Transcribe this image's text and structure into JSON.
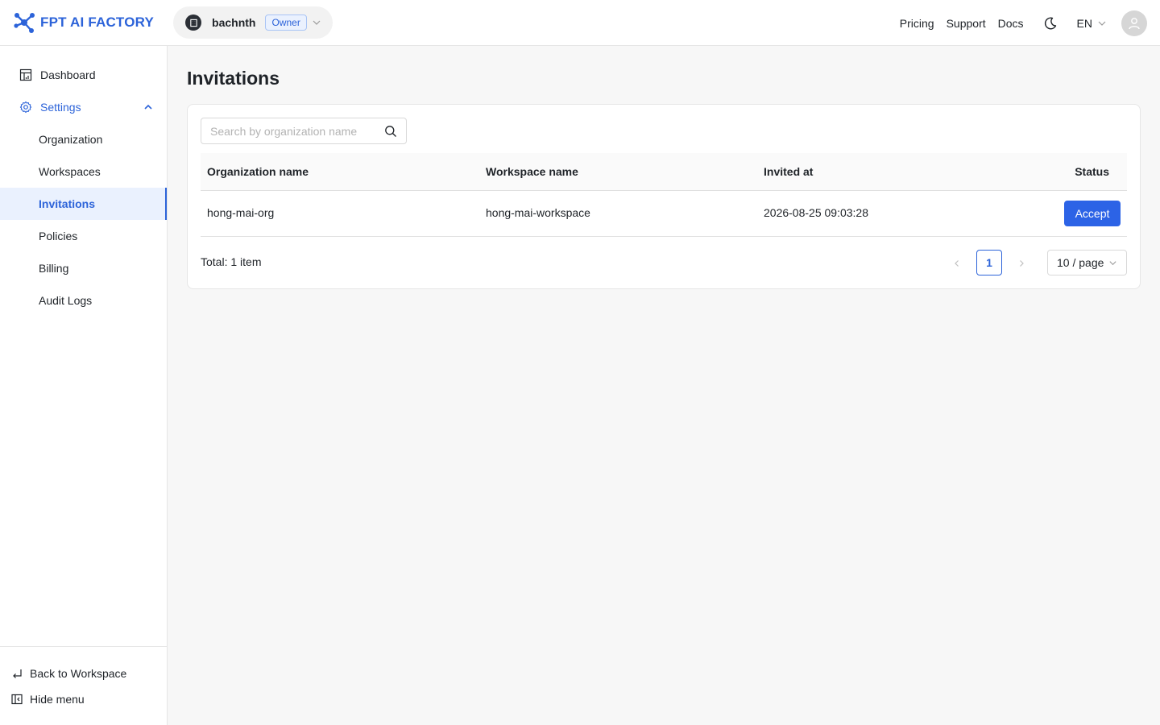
{
  "brand": {
    "name": "FPT AI FACTORY",
    "icon": "molecule-logo-icon",
    "color": "#2c63d9"
  },
  "org_switcher": {
    "name": "bachnth",
    "role_badge": "Owner"
  },
  "header": {
    "links": [
      "Pricing",
      "Support",
      "Docs"
    ],
    "language": "EN",
    "theme_icon": "moon-icon",
    "avatar_icon": "user-icon"
  },
  "sidebar": {
    "dashboard": "Dashboard",
    "settings": "Settings",
    "sub_items": [
      "Organization",
      "Workspaces",
      "Invitations",
      "Policies",
      "Billing",
      "Audit Logs"
    ],
    "active": "Invitations",
    "back": "Back to Workspace",
    "hide": "Hide menu"
  },
  "page": {
    "title": "Invitations"
  },
  "search": {
    "placeholder": "Search by organization name",
    "value": ""
  },
  "table": {
    "columns": [
      "Organization name",
      "Workspace name",
      "Invited at",
      "Status"
    ],
    "rows": [
      {
        "organization": "hong-mai-org",
        "workspace": "hong-mai-workspace",
        "invited_at": "2026-08-25 09:03:28",
        "action": "Accept"
      }
    ]
  },
  "pagination": {
    "total": "Total: 1 item",
    "current_page": "1",
    "page_size": "10 / page"
  },
  "colors": {
    "accent": "#2c63d9",
    "button": "#2c63e6",
    "active_bg": "#eaf1fe"
  }
}
